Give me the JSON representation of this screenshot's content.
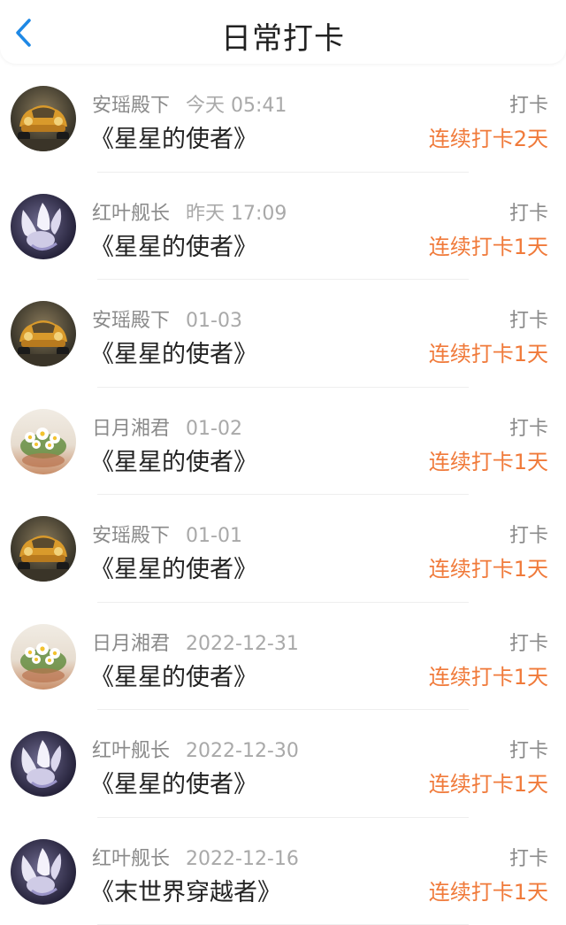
{
  "header": {
    "title": "日常打卡",
    "back_icon": "chevron-left-icon",
    "accent": "#1e88e5"
  },
  "colors": {
    "streak": "#f07a3a"
  },
  "entries": [
    {
      "avatar": "car",
      "name": "安瑶殿下",
      "time": "今天 05:41",
      "book": "《星星的使者》",
      "action": "打卡",
      "streak": "连续打卡2天"
    },
    {
      "avatar": "fox",
      "name": "红叶舰长",
      "time": "昨天 17:09",
      "book": "《星星的使者》",
      "action": "打卡",
      "streak": "连续打卡1天"
    },
    {
      "avatar": "car",
      "name": "安瑶殿下",
      "time": "01-03",
      "book": "《星星的使者》",
      "action": "打卡",
      "streak": "连续打卡1天"
    },
    {
      "avatar": "daisy",
      "name": "日月湘君",
      "time": "01-02",
      "book": "《星星的使者》",
      "action": "打卡",
      "streak": "连续打卡1天"
    },
    {
      "avatar": "car",
      "name": "安瑶殿下",
      "time": "01-01",
      "book": "《星星的使者》",
      "action": "打卡",
      "streak": "连续打卡1天"
    },
    {
      "avatar": "daisy",
      "name": "日月湘君",
      "time": "2022-12-31",
      "book": "《星星的使者》",
      "action": "打卡",
      "streak": "连续打卡1天"
    },
    {
      "avatar": "fox",
      "name": "红叶舰长",
      "time": "2022-12-30",
      "book": "《星星的使者》",
      "action": "打卡",
      "streak": "连续打卡1天"
    },
    {
      "avatar": "fox",
      "name": "红叶舰长",
      "time": "2022-12-16",
      "book": "《末世界穿越者》",
      "action": "打卡",
      "streak": "连续打卡1天"
    }
  ]
}
